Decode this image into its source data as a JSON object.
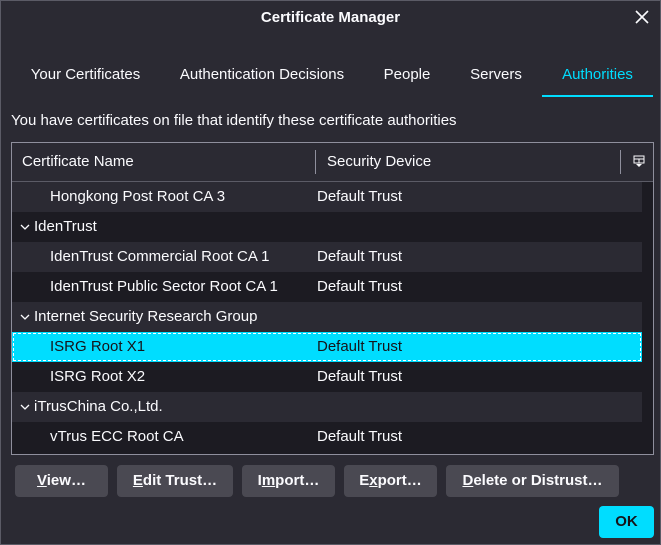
{
  "window": {
    "title": "Certificate Manager"
  },
  "tabs": [
    {
      "label": "Your Certificates"
    },
    {
      "label": "Authentication Decisions"
    },
    {
      "label": "People"
    },
    {
      "label": "Servers"
    },
    {
      "label": "Authorities",
      "selected": true
    }
  ],
  "description": "You have certificates on file that identify these certificate authorities",
  "table": {
    "columns": [
      "Certificate Name",
      "Security Device"
    ],
    "rows": [
      {
        "type": "cert",
        "name": "Hongkong Post Root CA 3",
        "device": "Default Trust"
      },
      {
        "type": "group",
        "name": "IdenTrust"
      },
      {
        "type": "cert",
        "name": "IdenTrust Commercial Root CA 1",
        "device": "Default Trust"
      },
      {
        "type": "cert",
        "name": "IdenTrust Public Sector Root CA 1",
        "device": "Default Trust"
      },
      {
        "type": "group",
        "name": "Internet Security Research Group"
      },
      {
        "type": "cert",
        "name": "ISRG Root X1",
        "device": "Default Trust",
        "selected": true
      },
      {
        "type": "cert",
        "name": "ISRG Root X2",
        "device": "Default Trust"
      },
      {
        "type": "group",
        "name": "iTrusChina Co.,Ltd."
      },
      {
        "type": "cert",
        "name": "vTrus ECC Root CA",
        "device": "Default Trust"
      }
    ]
  },
  "buttons": {
    "view": {
      "mnemonic": "V",
      "rest": "iew…"
    },
    "edit_trust": {
      "mnemonic": "E",
      "rest": "dit Trust…"
    },
    "import": {
      "pre": "I",
      "mnemonic": "m",
      "rest": "port…"
    },
    "export": {
      "pre": "E",
      "mnemonic": "x",
      "rest": "port…"
    },
    "delete": {
      "mnemonic": "D",
      "rest": "elete or Distrust…"
    },
    "ok": "OK"
  },
  "colors": {
    "accent": "#00ddff",
    "background": "#2b2a33",
    "tree_background": "#1c1b22"
  }
}
